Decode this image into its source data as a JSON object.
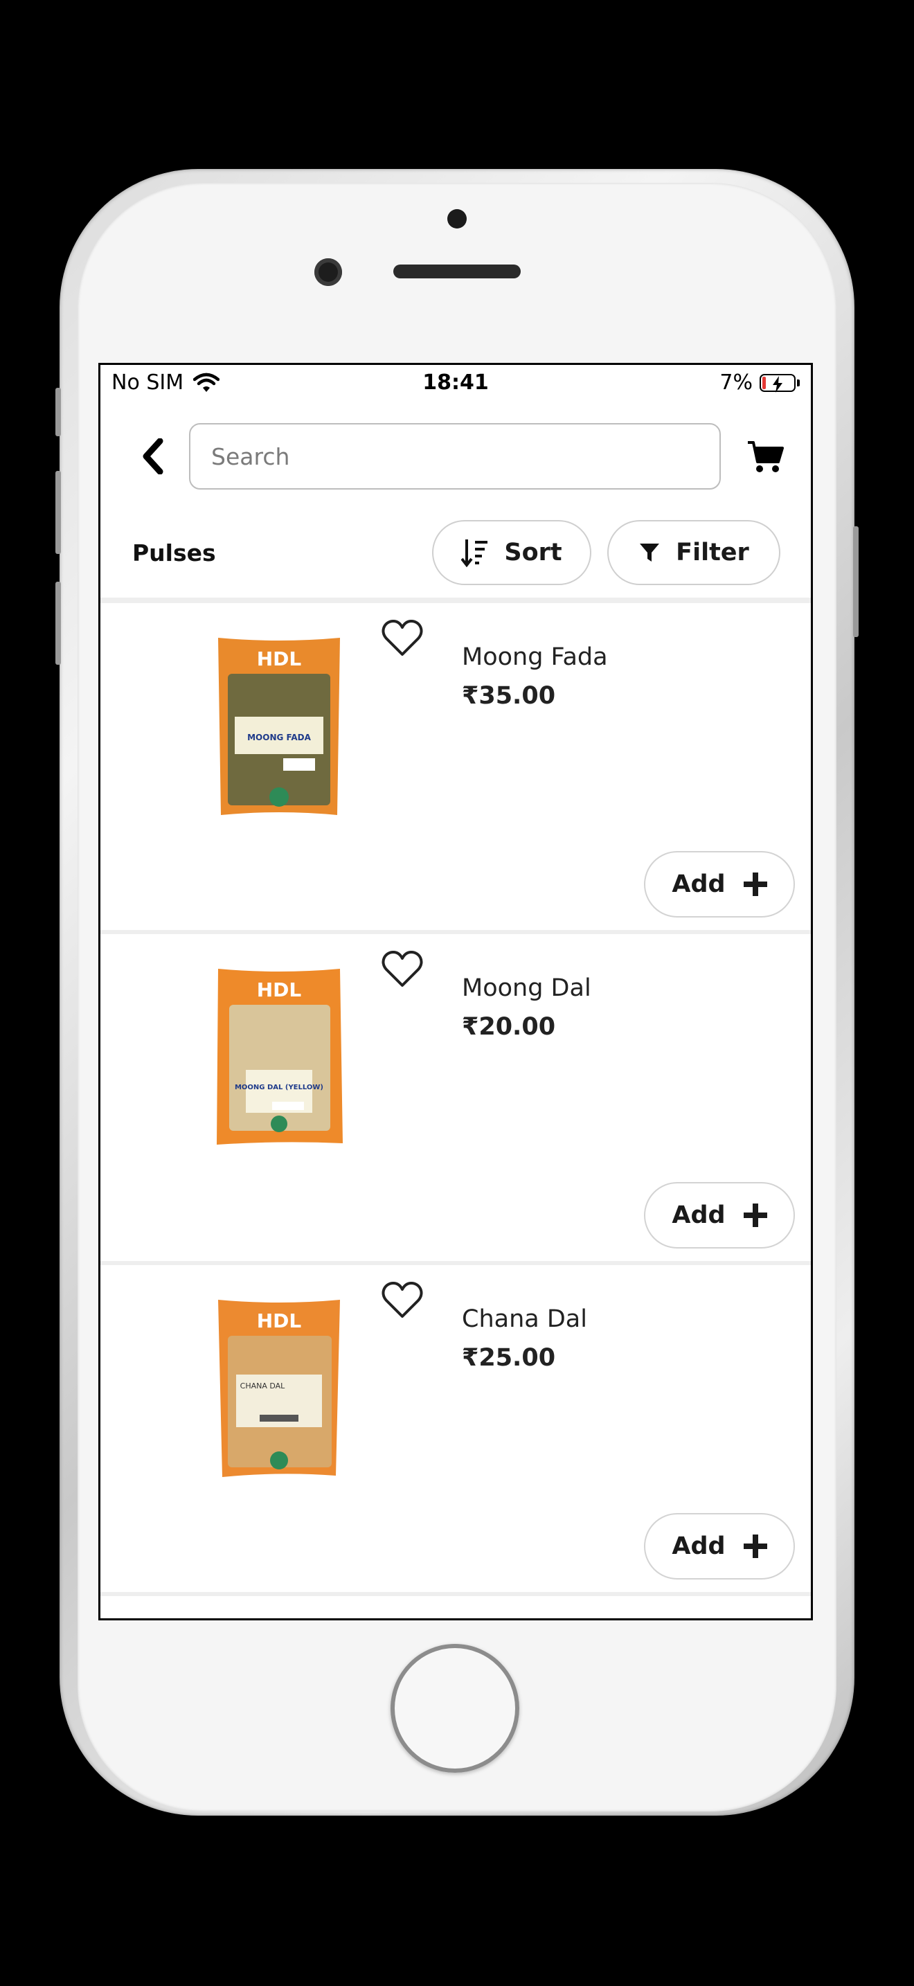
{
  "status_bar": {
    "carrier": "No SIM",
    "time": "18:41",
    "battery": "7%"
  },
  "header": {
    "search_placeholder": "Search"
  },
  "toolbar": {
    "category": "Pulses",
    "sort_label": "Sort",
    "filter_label": "Filter"
  },
  "products": [
    {
      "name": "Moong Fada",
      "price": "₹35.00",
      "add_label": "Add",
      "pack": {
        "brand": "HDL",
        "label": "MOONG FADA",
        "color": "#e98a2c",
        "fill": "#6f6a3f"
      }
    },
    {
      "name": "Moong Dal",
      "price": "₹20.00",
      "add_label": "Add",
      "pack": {
        "brand": "HDL",
        "label": "MOONG DAL (YELLOW)",
        "color": "#ee8a2a",
        "fill": "#d9c59a"
      }
    },
    {
      "name": "Chana Dal",
      "price": "₹25.00",
      "add_label": "Add",
      "pack": {
        "brand": "HDL",
        "label": "CHANA DAL",
        "color": "#ec8a30",
        "fill": "#d8a86a"
      }
    }
  ],
  "icons": {
    "back": "chevron-left-icon",
    "cart": "cart-icon",
    "sort": "sort-icon",
    "filter": "funnel-icon",
    "favorite": "heart-icon",
    "add": "plus-icon",
    "wifi": "wifi-icon",
    "battery": "battery-charging-icon"
  }
}
